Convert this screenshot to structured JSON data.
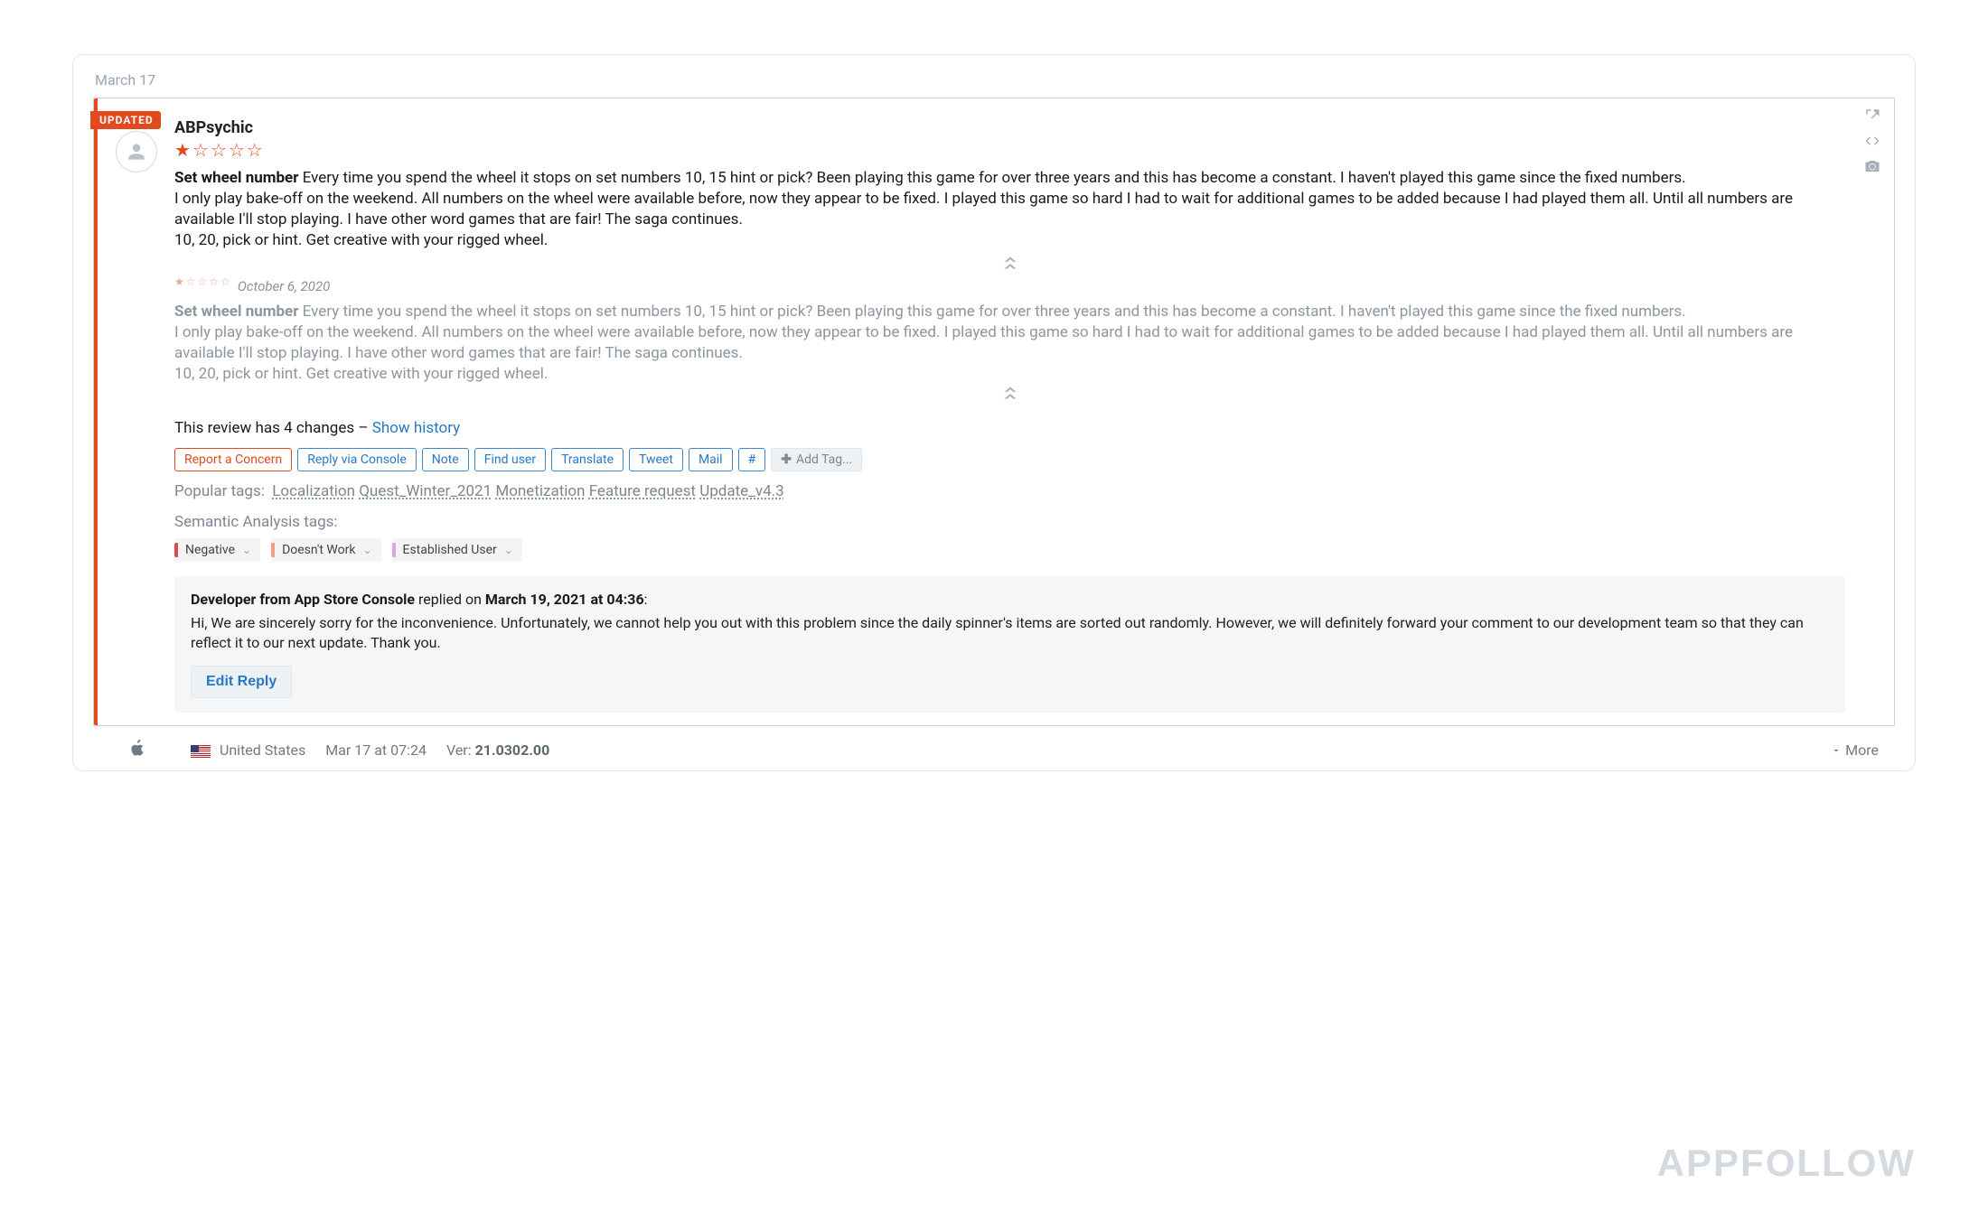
{
  "date_header": "March 17",
  "updated_badge": "UPDATED",
  "author": "ABPsychic",
  "rating_filled": 1,
  "rating_total": 5,
  "review": {
    "title": "Set wheel number",
    "body": "Every time you spend the wheel it stops on set numbers 10, 15 hint or pick? Been playing this game for over three years and this has become a constant. I haven't played this game since the fixed numbers.\nI only play bake-off on the weekend. All numbers on the wheel were available before, now they appear to be fixed. I played this game so hard I had to wait for additional games to be added because I had played them all. Until all numbers are available I'll stop playing. I have other word games that are fair! The saga continues.\n10, 20, pick or hint. Get creative with your rigged wheel."
  },
  "history": {
    "date": "October 6, 2020",
    "title": "Set wheel number",
    "body": "Every time you spend the wheel it stops on set numbers 10, 15 hint or pick? Been playing this game for over three years and this has become a constant. I haven't played this game since the fixed numbers.\nI only play bake-off on the weekend. All numbers on the wheel were available before, now they appear to be fixed. I played this game so hard I had to wait for additional games to be added because I had played them all. Until all numbers are available I'll stop playing. I have other word games that are fair! The saga continues.\n10, 20, pick or hint. Get creative with your rigged wheel."
  },
  "changes_line_prefix": "This review has 4 changes – ",
  "show_history": "Show history",
  "actions": {
    "report": "Report a Concern",
    "reply_console": "Reply via Console",
    "note": "Note",
    "find_user": "Find user",
    "translate": "Translate",
    "tweet": "Tweet",
    "mail": "Mail",
    "hash": "#",
    "add_tag": "Add Tag..."
  },
  "popular_tags_label": "Popular tags:",
  "popular_tags": [
    "Localization",
    "Quest_Winter_2021",
    "Monetization",
    "Feature request",
    "Update_v4.3"
  ],
  "semantic_label": "Semantic Analysis tags:",
  "semantic_tags": [
    {
      "label": "Negative",
      "color": "#e04a4a"
    },
    {
      "label": "Doesn't Work",
      "color": "#f0a084"
    },
    {
      "label": "Established User",
      "color": "#d9a7dc"
    }
  ],
  "reply": {
    "who_prefix": "Developer from App Store Console",
    "replied_on": "replied on",
    "when": "March 19, 2021 at 04:36",
    "body": "Hi, We are sincerely sorry for the inconvenience. Unfortunately, we cannot help you out with this problem since the daily spinner's items are sorted out randomly. However, we will definitely forward your comment to our development team so that they can reflect it to our next update. Thank you.",
    "edit_label": "Edit Reply"
  },
  "footer": {
    "country": "United States",
    "timestamp": "Mar 17 at 07:24",
    "ver_label": "Ver:",
    "version": "21.0302.00",
    "more": "More"
  },
  "watermark": "APPFOLLOW"
}
